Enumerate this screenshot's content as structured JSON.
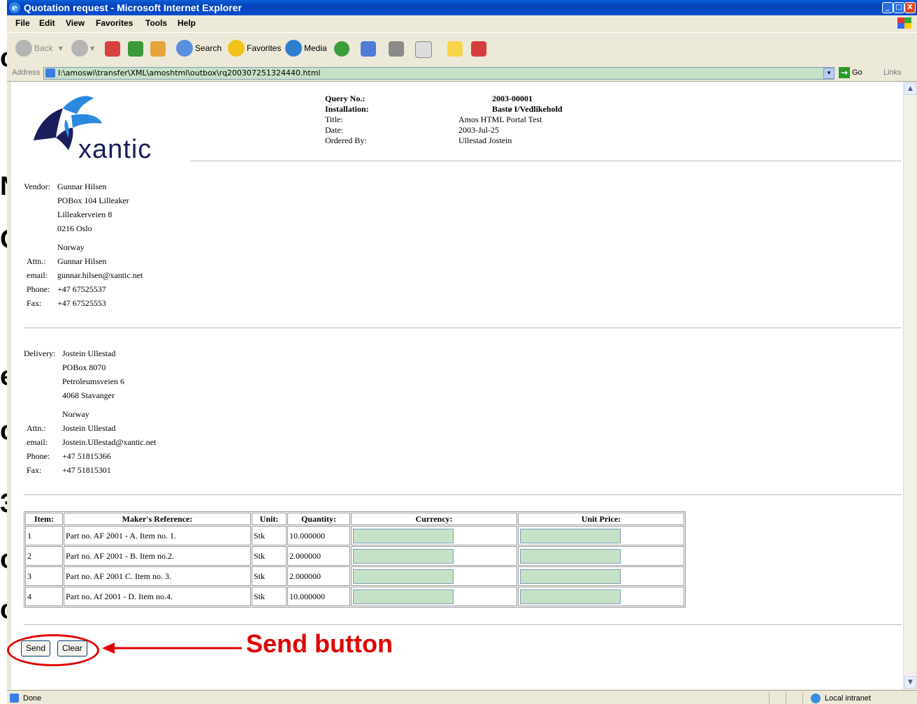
{
  "window": {
    "title": "Quotation request - Microsoft Internet Explorer",
    "minimize": "_",
    "maximize": "□",
    "close": "X"
  },
  "menu": [
    "File",
    "Edit",
    "View",
    "Favorites",
    "Tools",
    "Help"
  ],
  "toolbar": {
    "back": "Back",
    "search": "Search",
    "favorites": "Favorites",
    "media": "Media"
  },
  "address": {
    "label": "Address",
    "url": "I:\\amoswi\\transfer\\XML\\amoshtml\\outbox\\rq200307251324440.html",
    "go": "Go",
    "links": "Links"
  },
  "header": {
    "logo_text": "xantic",
    "query_no_label": "Query No.:",
    "query_no": "2003-00001",
    "installation_label": "Installation:",
    "installation": "Bastø I/Vedlikehold",
    "title_label": "Title:",
    "title": "Amos HTML Portal Test",
    "date_label": "Date:",
    "date": "2003-Jul-25",
    "ordered_by_label": "Ordered By:",
    "ordered_by": "Ullestad Jostein"
  },
  "vendor": {
    "label": "Vendor:",
    "name": "Gunnar Hilsen",
    "line1": "POBox 104 Lilleaker",
    "line2": "Lilleakerveien 8",
    "line3": "0216 Oslo",
    "country": "Norway",
    "attn_label": "Attn.:",
    "attn": "Gunnar Hilsen",
    "email_label": "email:",
    "email": "gunnar.hilsen@xantic.net",
    "phone_label": "Phone:",
    "phone": "+47 67525537",
    "fax_label": "Fax:",
    "fax": "+47 67525553"
  },
  "delivery": {
    "label": "Delivery:",
    "name": "Jostein Ullestad",
    "line1": "POBox 8070",
    "line2": "Petroleumsveien 6",
    "line3": "4068 Stavanger",
    "country": "Norway",
    "attn_label": "Attn.:",
    "attn": "Jostein Ullestad",
    "email_label": "email:",
    "email": "Jostein.Ullestad@xantic.net",
    "phone_label": "Phone:",
    "phone": "+47 51815366",
    "fax_label": "Fax:",
    "fax": "+47 51815301"
  },
  "table": {
    "headers": [
      "Item:",
      "Maker's Reference:",
      "Unit:",
      "Quantity:",
      "Currency:",
      "Unit Price:"
    ],
    "rows": [
      {
        "item": "1",
        "ref": "Part no. AF 2001 - A. Item no. 1.",
        "unit": "Stk",
        "qty": "10.000000"
      },
      {
        "item": "2",
        "ref": "Part no. AF 2001 - B. Item no.2.",
        "unit": "Stk",
        "qty": "2.000000"
      },
      {
        "item": "3",
        "ref": "Part no. AF 2001 C. Item no. 3.",
        "unit": "Stk",
        "qty": "2.000000"
      },
      {
        "item": "4",
        "ref": "Part no. Af 2001 - D. Item no.4.",
        "unit": "Stk",
        "qty": "10.000000"
      }
    ]
  },
  "buttons": {
    "send": "Send",
    "clear": "Clear"
  },
  "annotation": {
    "text": "Send button",
    "color": "#e00000"
  },
  "status": {
    "left": "Done",
    "zone": "Local intranet"
  },
  "colors": {
    "title_bar": "#0a4fd0",
    "input_fill": "#c6e2c6",
    "logo": "#1a1f5c"
  }
}
